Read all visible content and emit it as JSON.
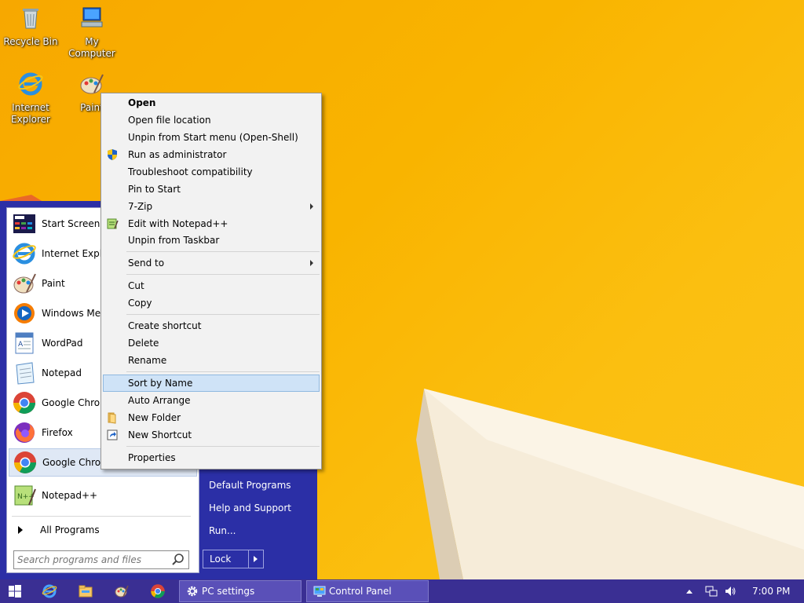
{
  "desktop": {
    "icons": [
      {
        "label": "Recycle Bin",
        "icon": "recycle-bin-icon"
      },
      {
        "label": "My Computer",
        "icon": "computer-icon"
      },
      {
        "label": "Internet Explorer",
        "icon": "internet-explorer-icon"
      },
      {
        "label": "Paint",
        "icon": "paint-icon"
      }
    ]
  },
  "start_menu": {
    "programs": [
      {
        "label": "Start Screen",
        "icon": "start-screen-icon"
      },
      {
        "label": "Internet Explorer",
        "icon": "internet-explorer-icon"
      },
      {
        "label": "Paint",
        "icon": "paint-icon"
      },
      {
        "label": "Windows Media Player",
        "icon": "media-player-icon"
      },
      {
        "label": "WordPad",
        "icon": "wordpad-icon"
      },
      {
        "label": "Notepad",
        "icon": "notepad-icon"
      },
      {
        "label": "Google Chrome",
        "icon": "chrome-icon"
      },
      {
        "label": "Firefox",
        "icon": "firefox-icon"
      },
      {
        "label": "Google Chrome",
        "icon": "chrome-icon"
      },
      {
        "label": "Notepad++",
        "icon": "notepadpp-icon"
      }
    ],
    "all_programs": "All Programs",
    "search_placeholder": "Search programs and files",
    "right_links": [
      "Default Programs",
      "Help and Support",
      "Run..."
    ],
    "lock_label": "Lock"
  },
  "context_menu": {
    "items": [
      "Open",
      "Open file location",
      "Unpin from Start menu (Open-Shell)",
      "Run as administrator",
      "Troubleshoot compatibility",
      "Pin to Start",
      "7-Zip",
      "Edit with Notepad++",
      "Unpin from Taskbar",
      "Send to",
      "Cut",
      "Copy",
      "Create shortcut",
      "Delete",
      "Rename",
      "Sort by Name",
      "Auto Arrange",
      "New Folder",
      "New Shortcut",
      "Properties"
    ],
    "highlighted": "Sort by Name"
  },
  "taskbar": {
    "tasks": [
      "PC settings",
      "Control Panel"
    ],
    "clock": "7:00 PM"
  },
  "colors": {
    "start_menu_bg": "#2b2fa6",
    "taskbar_bg": "#3a2f93",
    "wallpaper": "#f9b400",
    "highlight": "#cfe3f7"
  }
}
